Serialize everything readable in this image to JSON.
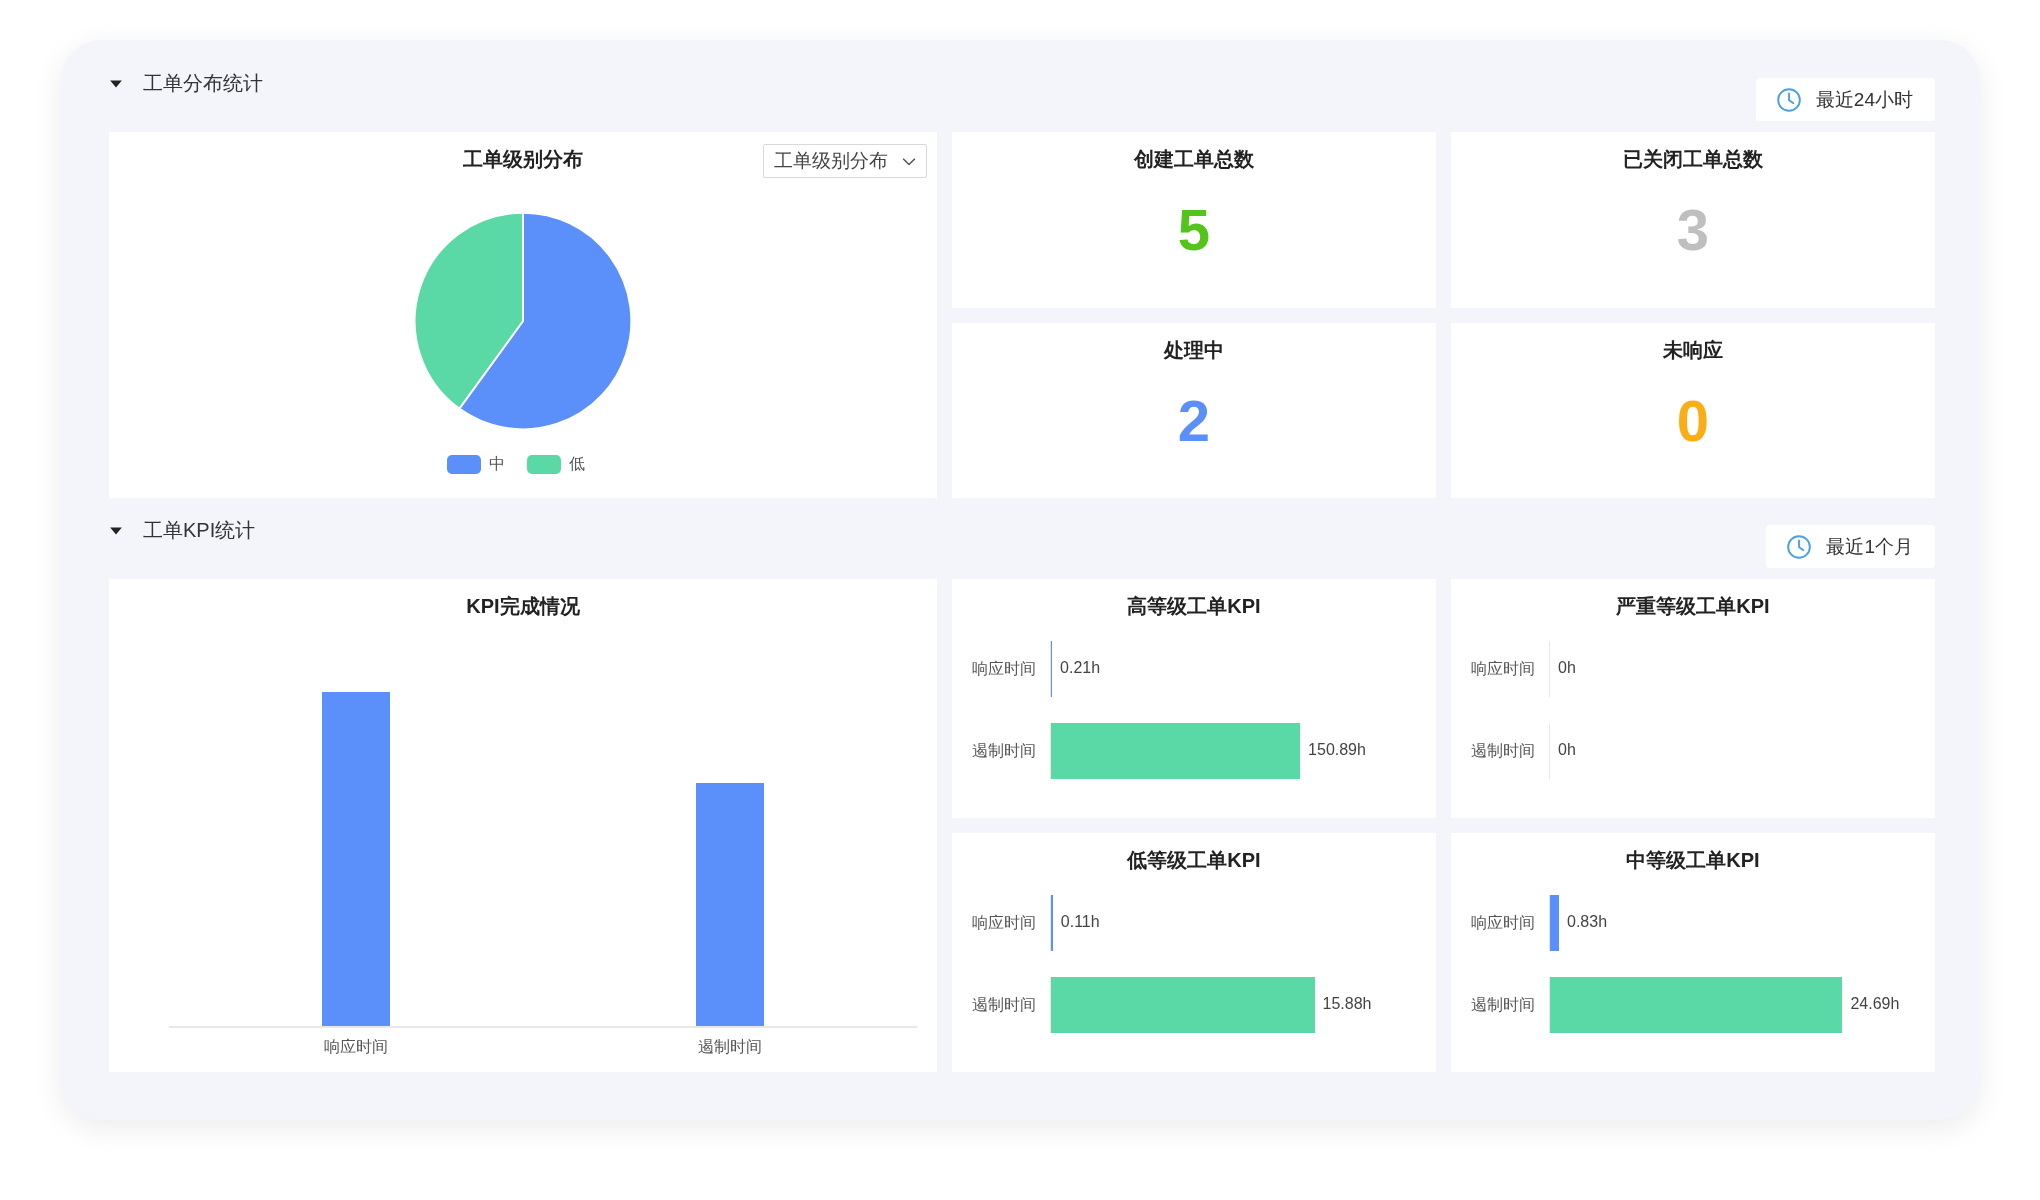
{
  "sections": [
    {
      "title": "工单分布统计",
      "expanded": true,
      "time_range": "最近24小时",
      "distribution": {
        "title": "工单级别分布",
        "dropdown": "工单级别分布",
        "legend": [
          {
            "label": "中",
            "color": "#5b8ff9"
          },
          {
            "label": "低",
            "color": "#5ad8a6"
          }
        ]
      },
      "stats": [
        {
          "title": "创建工单总数",
          "value": "5",
          "color": "#52c41a"
        },
        {
          "title": "已关闭工单总数",
          "value": "3",
          "color": "#bfbfbf"
        },
        {
          "title": "处理中",
          "value": "2",
          "color": "#5b8ff9"
        },
        {
          "title": "未响应",
          "value": "0",
          "color": "#faad14"
        }
      ]
    },
    {
      "title": "工单KPI统计",
      "expanded": true,
      "time_range": "最近1个月",
      "completion": {
        "title": "KPI完成情况",
        "x_labels": [
          "响应时间",
          "遏制时间"
        ]
      },
      "kpi_cards": [
        {
          "title": "高等级工单KPI",
          "rows": [
            {
              "label": "响应时间",
              "value": "0.21h",
              "level": 0.003,
              "color": "#5b8ff9"
            },
            {
              "label": "遏制时间",
              "value": "150.89h",
              "level": 0.69,
              "color": "#5ad8a6"
            }
          ]
        },
        {
          "title": "严重等级工单KPI",
          "rows": [
            {
              "label": "响应时间",
              "value": "0h"
            },
            {
              "label": "遏制时间",
              "value": "0h"
            }
          ]
        },
        {
          "title": "低等级工单KPI",
          "rows": [
            {
              "label": "响应时间",
              "value": "0.11h",
              "level": 0.005,
              "color": "#5b8ff9"
            },
            {
              "label": "遏制时间",
              "value": "15.88h",
              "level": 0.73,
              "color": "#5ad8a6"
            }
          ]
        },
        {
          "title": "中等级工单KPI",
          "rows": [
            {
              "label": "响应时间",
              "value": "0.83h",
              "level": 0.025,
              "color": "#5b8ff9"
            },
            {
              "label": "遏制时间",
              "value": "24.69h",
              "level": 0.81,
              "color": "#5ad8a6"
            }
          ]
        }
      ]
    }
  ]
}
